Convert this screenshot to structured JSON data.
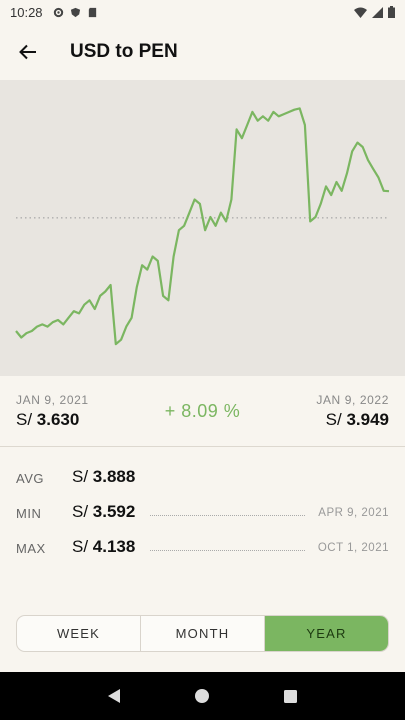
{
  "status_bar": {
    "time": "10:28"
  },
  "header": {
    "title": "USD to PEN",
    "back_icon": "arrow-back-icon"
  },
  "range": {
    "start_date": "JAN 9, 2021",
    "start_prefix": "S/",
    "start_value": "3.630",
    "end_date": "JAN 9, 2022",
    "end_prefix": "S/",
    "end_value": "3.949",
    "change": "+ 8.09 %"
  },
  "stats": {
    "avg": {
      "label": "AVG",
      "prefix": "S/",
      "value": "3.888"
    },
    "min": {
      "label": "MIN",
      "prefix": "S/",
      "value": "3.592",
      "date": "APR 9, 2021"
    },
    "max": {
      "label": "MAX",
      "prefix": "S/",
      "value": "4.138",
      "date": "OCT 1, 2021"
    }
  },
  "periods": [
    {
      "label": "WEEK",
      "active": false
    },
    {
      "label": "MONTH",
      "active": false
    },
    {
      "label": "YEAR",
      "active": true
    }
  ],
  "colors": {
    "accent": "#7bb661",
    "chart_bg": "#e8e5e0",
    "page_bg": "#f8f5ef"
  },
  "chart_data": {
    "type": "line",
    "ylim": [
      3.55,
      4.18
    ],
    "avg_line": 3.888,
    "points": [
      3.63,
      3.615,
      3.625,
      3.63,
      3.64,
      3.645,
      3.64,
      3.65,
      3.655,
      3.645,
      3.66,
      3.675,
      3.67,
      3.69,
      3.7,
      3.68,
      3.71,
      3.72,
      3.735,
      3.6,
      3.61,
      3.64,
      3.66,
      3.73,
      3.78,
      3.77,
      3.8,
      3.79,
      3.71,
      3.7,
      3.8,
      3.86,
      3.87,
      3.9,
      3.93,
      3.92,
      3.86,
      3.89,
      3.87,
      3.9,
      3.88,
      3.93,
      4.09,
      4.07,
      4.1,
      4.13,
      4.11,
      4.12,
      4.11,
      4.13,
      4.12,
      4.125,
      4.13,
      4.135,
      4.138,
      4.1,
      3.88,
      3.89,
      3.92,
      3.96,
      3.94,
      3.97,
      3.95,
      3.99,
      4.04,
      4.06,
      4.05,
      4.02,
      4.0,
      3.98,
      3.95,
      3.949
    ]
  }
}
